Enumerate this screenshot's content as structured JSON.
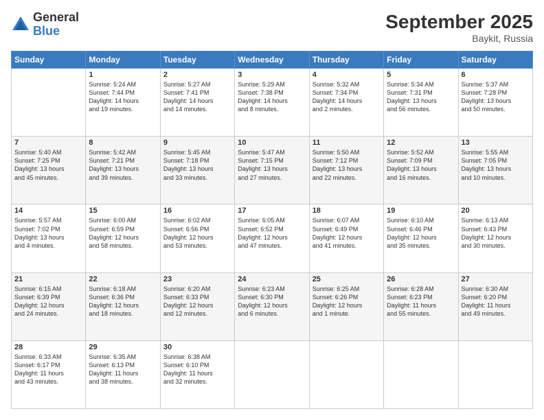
{
  "logo": {
    "general": "General",
    "blue": "Blue"
  },
  "title": "September 2025",
  "location": "Baykit, Russia",
  "headers": [
    "Sunday",
    "Monday",
    "Tuesday",
    "Wednesday",
    "Thursday",
    "Friday",
    "Saturday"
  ],
  "weeks": [
    [
      {
        "day": "",
        "lines": []
      },
      {
        "day": "1",
        "lines": [
          "Sunrise: 5:24 AM",
          "Sunset: 7:44 PM",
          "Daylight: 14 hours",
          "and 19 minutes."
        ]
      },
      {
        "day": "2",
        "lines": [
          "Sunrise: 5:27 AM",
          "Sunset: 7:41 PM",
          "Daylight: 14 hours",
          "and 14 minutes."
        ]
      },
      {
        "day": "3",
        "lines": [
          "Sunrise: 5:29 AM",
          "Sunset: 7:38 PM",
          "Daylight: 14 hours",
          "and 8 minutes."
        ]
      },
      {
        "day": "4",
        "lines": [
          "Sunrise: 5:32 AM",
          "Sunset: 7:34 PM",
          "Daylight: 14 hours",
          "and 2 minutes."
        ]
      },
      {
        "day": "5",
        "lines": [
          "Sunrise: 5:34 AM",
          "Sunset: 7:31 PM",
          "Daylight: 13 hours",
          "and 56 minutes."
        ]
      },
      {
        "day": "6",
        "lines": [
          "Sunrise: 5:37 AM",
          "Sunset: 7:28 PM",
          "Daylight: 13 hours",
          "and 50 minutes."
        ]
      }
    ],
    [
      {
        "day": "7",
        "lines": [
          "Sunrise: 5:40 AM",
          "Sunset: 7:25 PM",
          "Daylight: 13 hours",
          "and 45 minutes."
        ]
      },
      {
        "day": "8",
        "lines": [
          "Sunrise: 5:42 AM",
          "Sunset: 7:21 PM",
          "Daylight: 13 hours",
          "and 39 minutes."
        ]
      },
      {
        "day": "9",
        "lines": [
          "Sunrise: 5:45 AM",
          "Sunset: 7:18 PM",
          "Daylight: 13 hours",
          "and 33 minutes."
        ]
      },
      {
        "day": "10",
        "lines": [
          "Sunrise: 5:47 AM",
          "Sunset: 7:15 PM",
          "Daylight: 13 hours",
          "and 27 minutes."
        ]
      },
      {
        "day": "11",
        "lines": [
          "Sunrise: 5:50 AM",
          "Sunset: 7:12 PM",
          "Daylight: 13 hours",
          "and 22 minutes."
        ]
      },
      {
        "day": "12",
        "lines": [
          "Sunrise: 5:52 AM",
          "Sunset: 7:09 PM",
          "Daylight: 13 hours",
          "and 16 minutes."
        ]
      },
      {
        "day": "13",
        "lines": [
          "Sunrise: 5:55 AM",
          "Sunset: 7:05 PM",
          "Daylight: 13 hours",
          "and 10 minutes."
        ]
      }
    ],
    [
      {
        "day": "14",
        "lines": [
          "Sunrise: 5:57 AM",
          "Sunset: 7:02 PM",
          "Daylight: 13 hours",
          "and 4 minutes."
        ]
      },
      {
        "day": "15",
        "lines": [
          "Sunrise: 6:00 AM",
          "Sunset: 6:59 PM",
          "Daylight: 12 hours",
          "and 58 minutes."
        ]
      },
      {
        "day": "16",
        "lines": [
          "Sunrise: 6:02 AM",
          "Sunset: 6:56 PM",
          "Daylight: 12 hours",
          "and 53 minutes."
        ]
      },
      {
        "day": "17",
        "lines": [
          "Sunrise: 6:05 AM",
          "Sunset: 6:52 PM",
          "Daylight: 12 hours",
          "and 47 minutes."
        ]
      },
      {
        "day": "18",
        "lines": [
          "Sunrise: 6:07 AM",
          "Sunset: 6:49 PM",
          "Daylight: 12 hours",
          "and 41 minutes."
        ]
      },
      {
        "day": "19",
        "lines": [
          "Sunrise: 6:10 AM",
          "Sunset: 6:46 PM",
          "Daylight: 12 hours",
          "and 35 minutes."
        ]
      },
      {
        "day": "20",
        "lines": [
          "Sunrise: 6:13 AM",
          "Sunset: 6:43 PM",
          "Daylight: 12 hours",
          "and 30 minutes."
        ]
      }
    ],
    [
      {
        "day": "21",
        "lines": [
          "Sunrise: 6:15 AM",
          "Sunset: 6:39 PM",
          "Daylight: 12 hours",
          "and 24 minutes."
        ]
      },
      {
        "day": "22",
        "lines": [
          "Sunrise: 6:18 AM",
          "Sunset: 6:36 PM",
          "Daylight: 12 hours",
          "and 18 minutes."
        ]
      },
      {
        "day": "23",
        "lines": [
          "Sunrise: 6:20 AM",
          "Sunset: 6:33 PM",
          "Daylight: 12 hours",
          "and 12 minutes."
        ]
      },
      {
        "day": "24",
        "lines": [
          "Sunrise: 6:23 AM",
          "Sunset: 6:30 PM",
          "Daylight: 12 hours",
          "and 6 minutes."
        ]
      },
      {
        "day": "25",
        "lines": [
          "Sunrise: 6:25 AM",
          "Sunset: 6:26 PM",
          "Daylight: 12 hours",
          "and 1 minute."
        ]
      },
      {
        "day": "26",
        "lines": [
          "Sunrise: 6:28 AM",
          "Sunset: 6:23 PM",
          "Daylight: 11 hours",
          "and 55 minutes."
        ]
      },
      {
        "day": "27",
        "lines": [
          "Sunrise: 6:30 AM",
          "Sunset: 6:20 PM",
          "Daylight: 11 hours",
          "and 49 minutes."
        ]
      }
    ],
    [
      {
        "day": "28",
        "lines": [
          "Sunrise: 6:33 AM",
          "Sunset: 6:17 PM",
          "Daylight: 11 hours",
          "and 43 minutes."
        ]
      },
      {
        "day": "29",
        "lines": [
          "Sunrise: 6:35 AM",
          "Sunset: 6:13 PM",
          "Daylight: 11 hours",
          "and 38 minutes."
        ]
      },
      {
        "day": "30",
        "lines": [
          "Sunrise: 6:38 AM",
          "Sunset: 6:10 PM",
          "Daylight: 11 hours",
          "and 32 minutes."
        ]
      },
      {
        "day": "",
        "lines": []
      },
      {
        "day": "",
        "lines": []
      },
      {
        "day": "",
        "lines": []
      },
      {
        "day": "",
        "lines": []
      }
    ]
  ]
}
